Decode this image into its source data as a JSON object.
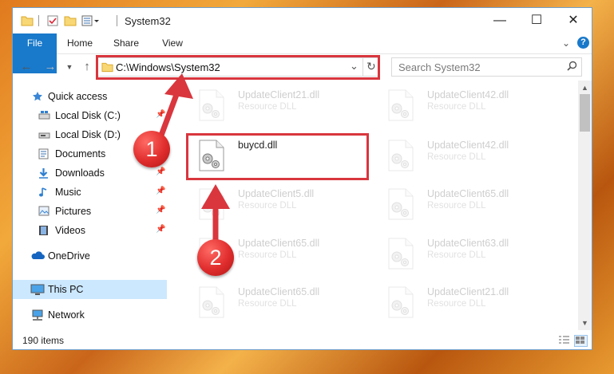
{
  "window": {
    "title": "System32"
  },
  "ribbon": {
    "tabs": [
      "File",
      "Home",
      "Share",
      "View"
    ]
  },
  "address": {
    "path": "C:\\Windows\\System32"
  },
  "search": {
    "placeholder": "Search System32"
  },
  "sidebar": {
    "items": [
      {
        "label": "Quick access",
        "icon": "star-icon"
      },
      {
        "label": "Local Disk (C:)",
        "icon": "drive-icon"
      },
      {
        "label": "Local Disk (D:)",
        "icon": "drive-icon"
      },
      {
        "label": "Documents",
        "icon": "documents-icon"
      },
      {
        "label": "Downloads",
        "icon": "download-icon"
      },
      {
        "label": "Music",
        "icon": "music-icon"
      },
      {
        "label": "Pictures",
        "icon": "pictures-icon"
      },
      {
        "label": "Videos",
        "icon": "videos-icon"
      },
      {
        "label": "OneDrive",
        "icon": "cloud-icon"
      },
      {
        "label": "This PC",
        "icon": "computer-icon"
      },
      {
        "label": "Network",
        "icon": "network-icon"
      }
    ]
  },
  "files": {
    "highlighted": {
      "name": "buycd.dll"
    },
    "faded": [
      {
        "name": "UpdateClient21.dll",
        "type": "Resource DLL"
      },
      {
        "name": "UpdateClient42.dll",
        "type": "Resource DLL"
      },
      {
        "name": "UpdateClient42.dll",
        "type": "Resource DLL"
      },
      {
        "name": "UpdateClient5.dll",
        "type": "Resource DLL"
      },
      {
        "name": "UpdateClient65.dll",
        "type": "Resource DLL"
      },
      {
        "name": "UpdateClient65.dll",
        "type": "Resource DLL"
      },
      {
        "name": "UpdateClient63.dll",
        "type": "Resource DLL"
      },
      {
        "name": "UpdateClient65.dll",
        "type": "Resource DLL"
      },
      {
        "name": "UpdateClient21.dll",
        "type": "Resource DLL"
      }
    ]
  },
  "status": {
    "count": "190 items"
  },
  "callouts": [
    "1",
    "2"
  ],
  "colors": {
    "accent": "#1979ca",
    "highlight": "#d9363e",
    "selected": "#cce8ff"
  }
}
